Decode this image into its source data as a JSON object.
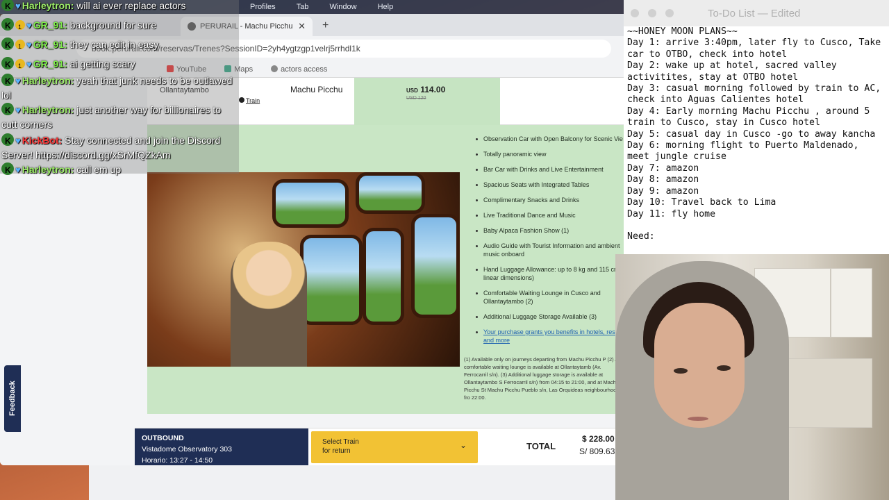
{
  "menubar": {
    "items": [
      "Profiles",
      "Tab",
      "Window",
      "Help"
    ]
  },
  "browser": {
    "tab_title": "PERURAIL - Machu Picchu av",
    "url": "book.perurail.com/reservas/Trenes?SessionID=2yh4ygtzgp1velrj5rrhdl1k",
    "bookmarks": [
      "YouTube",
      "Maps",
      "actors access"
    ]
  },
  "route": {
    "station_a": "Ollantaytambo",
    "station_b": "Machu Picchu",
    "train_link": "Train",
    "price": "114.00",
    "currency": "USD",
    "old_price": "USD 120"
  },
  "features": [
    "Observation Car with Open Balcony for Scenic Vie",
    "Totally panoramic view",
    "Bar Car with Drinks and Live Entertainment",
    "Spacious Seats with Integrated Tables",
    "Complimentary Snacks and Drinks",
    "Live Traditional Dance and Music",
    "Baby Alpaca Fashion Show (1)",
    "Audio Guide with Tourist Information and ambient music onboard",
    "Hand Luggage Allowance: up to 8 kg and 115 cr linear dimensions)",
    "Comfortable Waiting Lounge in Cusco and Ollantaytambo (2)",
    "Additional Luggage Storage Available (3)"
  ],
  "benefits_link": "Your purchase grants you benefits in hotels, rest and more",
  "footnotes": "(1) Available only on journeys departing from Machu Picchu P\n(2) A comfortable waiting lounge is available at Ollantaytamb (Av. Ferrocarril s/n).\n(3) Additional luggage storage is available at Ollantaytambo S Ferrocarril s/n) from 04:15 to 21:00, and at Machu Picchu St Machu Picchu Pueblo s/n, Las Orquideas neighbourhood) fro 22:00.",
  "bottom": {
    "outbound_heading": "OUTBOUND",
    "outbound_train": "Vistadome Observatory 303",
    "outbound_time": "Horario: 13:27 - 14:50",
    "select_line1": "Select Train",
    "select_line2": "for return",
    "total_label": "TOTAL",
    "total_usd": "$ 228.00",
    "total_sol": "S/ 809.63"
  },
  "feedback_label": "Feedback",
  "chat": [
    {
      "user": "Harleytron:",
      "msg": " will ai ever replace actors",
      "kind": "harley"
    },
    {
      "user": "GR_91:",
      "msg": " background for sure",
      "kind": "gr"
    },
    {
      "user": "GR_91:",
      "msg": " they can edit in easy",
      "kind": "gr"
    },
    {
      "user": "GR_91:",
      "msg": " ai getting scary",
      "kind": "gr"
    },
    {
      "user": "Harleytron:",
      "msg": " yeah that junk needs to be outlawed lol",
      "kind": "harley"
    },
    {
      "user": "Harleytron:",
      "msg": " just another way for billionaires to cutt corners",
      "kind": "harley"
    },
    {
      "user": "KickBot:",
      "msg": " Stay connected and join the Discord Server! https://discord.gg/xSrMfQZkAm",
      "kind": "kick"
    },
    {
      "user": "Harleytron:",
      "msg": " call em up",
      "kind": "harley"
    }
  ],
  "notes": {
    "window_title": "To-Do List — Edited",
    "body": "~~HONEY MOON PLANS~~\nDay 1: arrive 3:40pm, later fly to Cusco, Take car to OTBO, check into hotel\nDay 2: wake up at hotel, sacred valley activitites, stay at OTBO hotel\nDay 3: casual morning followed by train to AC, check into Aguas Calientes hotel\nDay 4: Early morning Machu Picchu , around 5 train to Cusco, stay in Cusco hotel\nDay 5: casual day in Cusco -go to away kancha\nDay 6: morning flight to Puerto Maldenado, meet jungle cruise\nDay 7: amazon\nDay 8: amazon\nDay 9: amazon\nDay 10: Travel back to Lima\nDay 11: fly home\n\nNeed:"
  },
  "colors": {
    "accent_navy": "#1f2e55",
    "accent_yellow": "#f2c234",
    "panel_green": "#c9e6c5"
  }
}
